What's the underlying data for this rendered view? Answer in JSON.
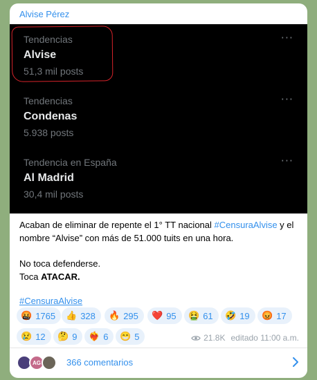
{
  "message": {
    "author": "Alvise Pérez",
    "trends": [
      {
        "category": "Tendencias",
        "name": "Alvise",
        "posts": "51,3 mil posts"
      },
      {
        "category": "Tendencias",
        "name": "Condenas",
        "posts": "5.938 posts"
      },
      {
        "category": "Tendencia en España",
        "name": "Al Madrid",
        "posts": "30,4 mil posts"
      }
    ],
    "more_glyph": "···",
    "text": {
      "line1_before": "Acaban de eliminar de repente el 1° TT nacional ",
      "line1_link": "#CensuraAlvise",
      "line1_after": " y el nombre “Alvise” con más de 51.000 tuits en una hora.",
      "line2": "No toca defenderse.",
      "line3_before": "Toca ",
      "line3_bold": "ATACAR."
    },
    "hashtag": "#CensuraAlvise",
    "reactions": [
      {
        "emoji": "🤬",
        "count": "1765"
      },
      {
        "emoji": "👍",
        "count": "328"
      },
      {
        "emoji": "🔥",
        "count": "295"
      },
      {
        "emoji": "❤️",
        "count": "95"
      },
      {
        "emoji": "🤮",
        "count": "61"
      },
      {
        "emoji": "🤣",
        "count": "19"
      },
      {
        "emoji": "😡",
        "count": "17"
      },
      {
        "emoji": "😢",
        "count": "12"
      },
      {
        "emoji": "🤔",
        "count": "9"
      },
      {
        "emoji": "❤️‍🔥",
        "count": "6"
      },
      {
        "emoji": "😁",
        "count": "5"
      }
    ],
    "views": "21.8K",
    "edited": "editado 11:00 a.m.",
    "comments": "366 comentarios",
    "avatar_initials": "AG",
    "colors": {
      "accent": "#3390ec",
      "media_bg": "#000000",
      "annotation": "#d8232a"
    }
  }
}
